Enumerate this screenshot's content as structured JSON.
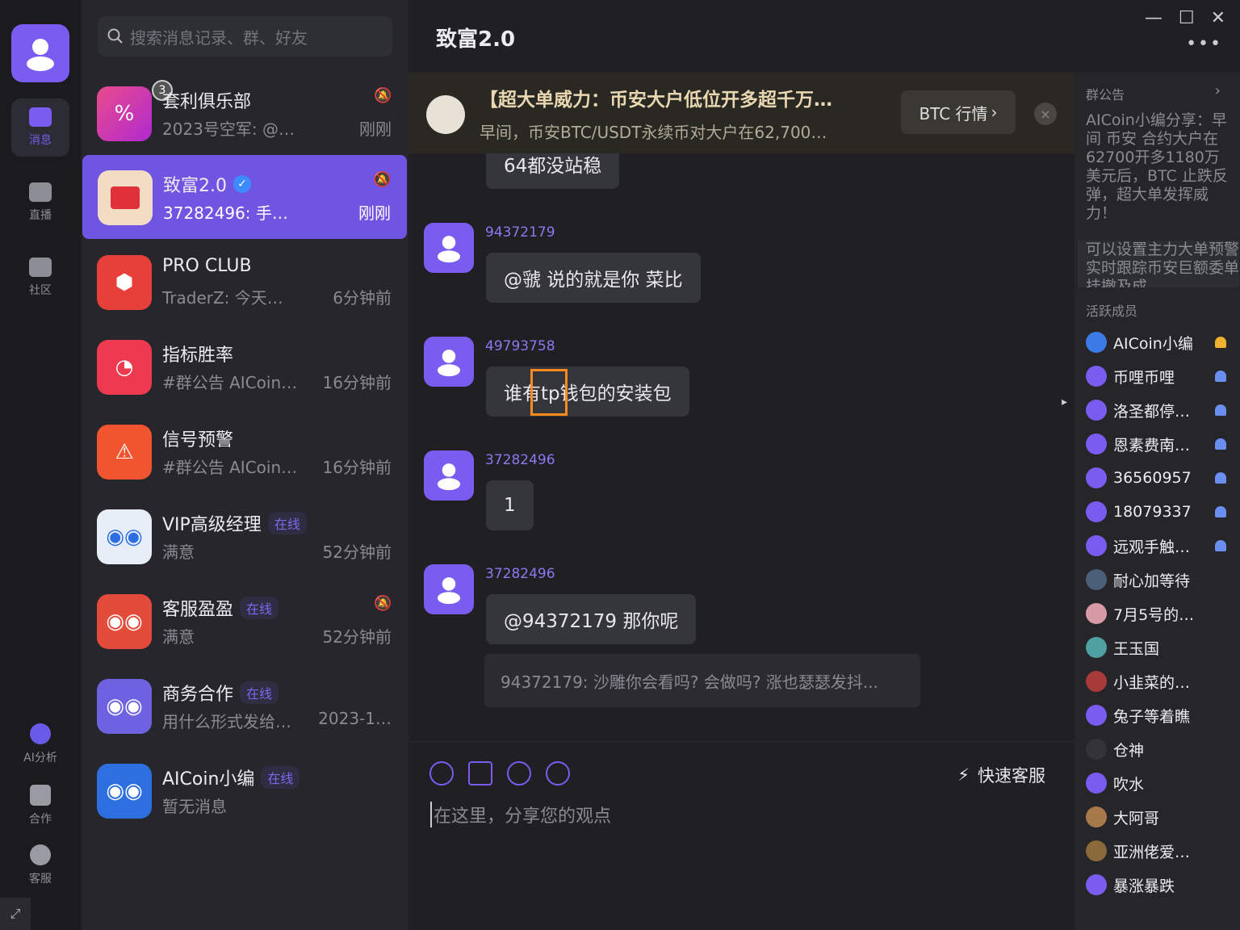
{
  "search": {
    "placeholder": "搜索消息记录、群、好友"
  },
  "rail": {
    "items": [
      {
        "label": "消息",
        "icon": "chat-icon"
      },
      {
        "label": "直播",
        "icon": "tv-icon"
      },
      {
        "label": "社区",
        "icon": "community-icon"
      }
    ],
    "bottom": [
      {
        "label": "AI分析",
        "icon": "robot-icon"
      },
      {
        "label": "合作",
        "icon": "briefcase-icon"
      },
      {
        "label": "客服",
        "icon": "headset-icon"
      }
    ]
  },
  "conversations": [
    {
      "name": "套利俱乐部",
      "preview": "2023号空军: @…",
      "time": "刚刚",
      "badge": "3",
      "muted": true,
      "color": "#d437a5"
    },
    {
      "name": "致富2.0",
      "preview": "37282496: 手…",
      "time": "刚刚",
      "muted": true,
      "verified": true,
      "color": "#f3dcc4"
    },
    {
      "name": "PRO CLUB",
      "preview": "TraderZ: 今天…",
      "time": "6分钟前",
      "color": "#e7403a"
    },
    {
      "name": "指标胜率",
      "preview": "#群公告 AICoin…",
      "time": "16分钟前",
      "color": "#ee3a50"
    },
    {
      "name": "信号预警",
      "preview": "#群公告 AICoin…",
      "time": "16分钟前",
      "color": "#f0552f"
    },
    {
      "name": "VIP高级经理",
      "online": "在线",
      "preview": "满意",
      "time": "52分钟前",
      "color": "#e8eef8"
    },
    {
      "name": "客服盈盈",
      "online": "在线",
      "preview": "满意",
      "time": "52分钟前",
      "muted": true,
      "color": "#e34b3b"
    },
    {
      "name": "商务合作",
      "online": "在线",
      "preview": "用什么形式发给…",
      "time": "2023-1…",
      "color": "#6f62e0"
    },
    {
      "name": "AICoin小编",
      "online": "在线",
      "preview": "暂无消息",
      "time": "",
      "color": "#2d6fe0"
    }
  ],
  "chat": {
    "title": "致富2.0",
    "pinned": {
      "headline": "【超大单威力：币安大户低位开多超千万…",
      "sub": "早间，币安BTC/USDT永续币对大户在62,700…",
      "button": "BTC 行情"
    },
    "partial_message": "64都没站稳",
    "messages": [
      {
        "user": "94372179",
        "text": "@虢  说的就是你 菜比"
      },
      {
        "user": "49793758",
        "text": "谁有tp钱包的安装包"
      },
      {
        "user": "37282496",
        "text": "1"
      },
      {
        "user": "37282496",
        "text": "@94372179  那你呢"
      }
    ],
    "reply_quote": "94372179: 沙雕你会看吗? 会做吗? 涨也瑟瑟发抖...",
    "composer": {
      "placeholder": "在这里，分享您的观点",
      "quick_service": "快速客服"
    }
  },
  "side": {
    "notice_label": "群公告",
    "notice_text": "AICoin小编分享：早间 币安 合约大户在62700开多1180万美元后，BTC 止跌反弹，超大单发挥威力！",
    "notice_text2": "可以设置主力大单预警实时跟踪币安巨额委单挂撤及成",
    "members_label": "活跃成员",
    "members": [
      {
        "name": "AICoin小编",
        "admin": "gold",
        "color": "#3c7be6"
      },
      {
        "name": "币哩币哩",
        "admin": "blue",
        "color": "#7a5cf0"
      },
      {
        "name": "洛圣都停…",
        "admin": "blue",
        "color": "#7a5cf0"
      },
      {
        "name": "恩素费南…",
        "admin": "blue",
        "color": "#7a5cf0"
      },
      {
        "name": "36560957",
        "admin": "blue",
        "color": "#7a5cf0"
      },
      {
        "name": "18079337",
        "admin": "blue",
        "color": "#7a5cf0"
      },
      {
        "name": "远观手触…",
        "admin": "blue",
        "color": "#7a5cf0"
      },
      {
        "name": "耐心加等待",
        "color": "#4a6078"
      },
      {
        "name": "7月5号的…",
        "color": "#d99aa8"
      },
      {
        "name": "王玉国",
        "color": "#4fa0a0"
      },
      {
        "name": "小韭菜的…",
        "color": "#a83a3a"
      },
      {
        "name": "兔子等着瞧",
        "color": "#7a5cf0"
      },
      {
        "name": "仓神",
        "color": "#333339"
      },
      {
        "name": "吹水",
        "color": "#7a5cf0"
      },
      {
        "name": "大阿哥",
        "color": "#a87a4a"
      },
      {
        "name": "亚洲佬爱…",
        "color": "#8a6a3a"
      },
      {
        "name": "暴涨暴跌",
        "color": "#7a5cf0"
      }
    ]
  }
}
